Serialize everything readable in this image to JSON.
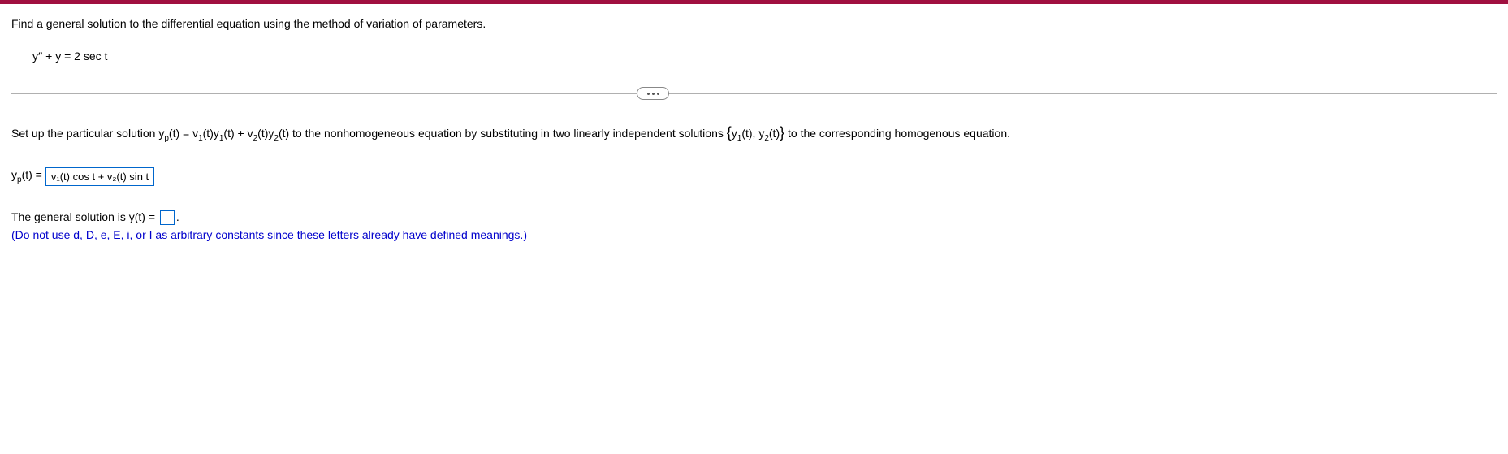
{
  "instruction": "Find a general solution to the differential equation using the method of variation of parameters.",
  "equation": "y′′ + y = 2 sec t",
  "setup": {
    "prefix": "Set up the particular solution ",
    "yp_definition": "y",
    "yp_sub": "p",
    "yp_t": "(t) = v",
    "sub1": "1",
    "yp_part1": "(t)y",
    "yp_part2": "(t) + v",
    "sub2": "2",
    "yp_part3": "(t)y",
    "yp_part4": "(t) to the nonhomogeneous equation by substituting in two linearly independent solutions ",
    "set_y1": "y",
    "set_y1_t": "(t), y",
    "set_y2_t": "(t)",
    "suffix": " to the corresponding homogenous equation."
  },
  "yp_line": {
    "prefix_y": "y",
    "prefix_p": "p",
    "prefix_t": "(t) = ",
    "answer": "v₁(t) cos t + v₂(t) sin t"
  },
  "general": {
    "text": "The general solution is y(t) = ",
    "period": "."
  },
  "note": "(Do not use d, D, e, E, i, or I as arbitrary constants since these letters already have defined meanings.)"
}
